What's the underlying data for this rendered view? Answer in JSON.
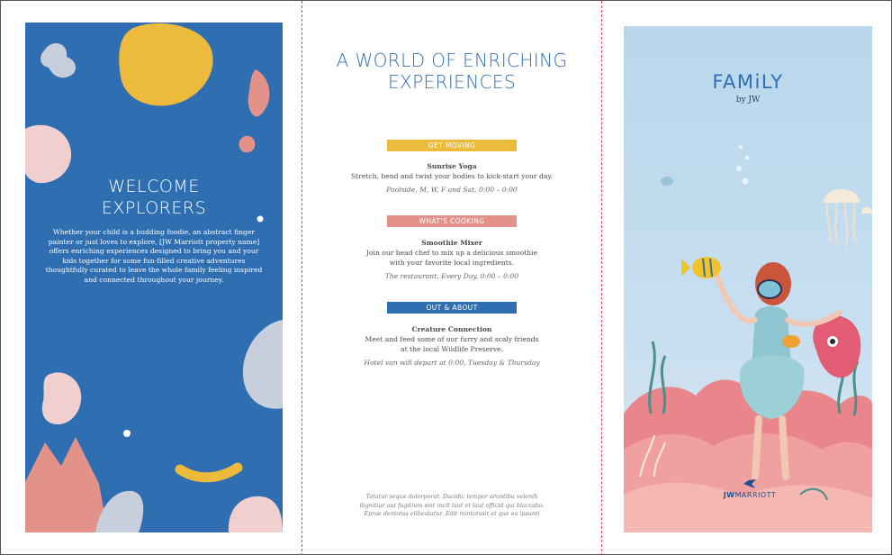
{
  "left_panel": {
    "title": "WELCOME\nEXPLORERS",
    "body": "Whether your child is a budding foodie, an abstract finger painter or just loves to explore, [JW Marriott property name] offers enriching experiences designed to bring you and your kids together for some fun-filled creative adventures thoughtfully curated to leave the whole family feeling inspired and connected throughout your journey."
  },
  "middle_panel": {
    "title": "A WORLD OF ENRICHING\nEXPERIENCES",
    "sections": [
      {
        "banner": "GET MOVING",
        "activity_title": "Sunrise Yoga",
        "description": "Stretch, bend and twist your bodies to kick-start your day.",
        "when": "Poolside, M, W, F and Sat, 0:00 – 0:00"
      },
      {
        "banner": "WHAT’S COOKING",
        "activity_title": "Smoothie Mixer",
        "description": "Join our head chef to mix up a delicious smoothie\nwith your favorite local ingredients.",
        "when": "The restaurant, Every Day, 0:00 – 0:00"
      },
      {
        "banner": "OUT & ABOUT",
        "activity_title": "Creature Connection",
        "description": "Meet and feed some of our furry and scaly friends\nat the local Wildlife Preserve.",
        "when": "Hotel van will depart at 0:00, Tuesday & Thursday"
      }
    ],
    "footer": "Totatur seque dolorporat. Ducidic tempor aruntibu velenih\nilignitiur aut fugitium sint incit laut et laut officid qui blaccabo.\nEprae dentotas elibeatatur. Edit mintotasit et que ea ipsunti"
  },
  "right_panel": {
    "logo": "FAMiLY",
    "logo_sub": "by JW",
    "brand_bold": "JW",
    "brand_rest": "MARRIOTT"
  },
  "colors": {
    "blue": "#2f6fb1",
    "yellow": "#ecbb3c",
    "pink": "#e39289",
    "fold_line": "#e23c78"
  }
}
